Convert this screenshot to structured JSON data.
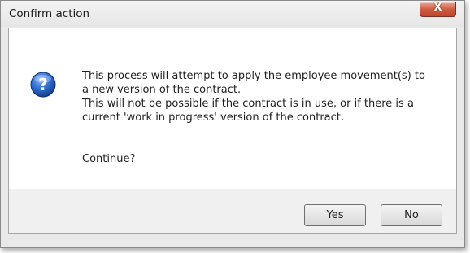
{
  "window": {
    "title": "Confirm action",
    "close_glyph": "X"
  },
  "dialog": {
    "icon": "question-icon",
    "message_lines": [
      "This process will attempt to apply the employee movement(s) to",
      "a new version of the contract.",
      "This will not be possible if the contract is in use, or if there is a",
      "current 'work in progress' version of the contract."
    ],
    "prompt": "Continue?"
  },
  "buttons": {
    "yes_label": "Yes",
    "no_label": "No"
  },
  "colors": {
    "icon_blue": "#2f6fd1",
    "close_red": "#c9503a",
    "button_area": "#f0f0f0"
  }
}
